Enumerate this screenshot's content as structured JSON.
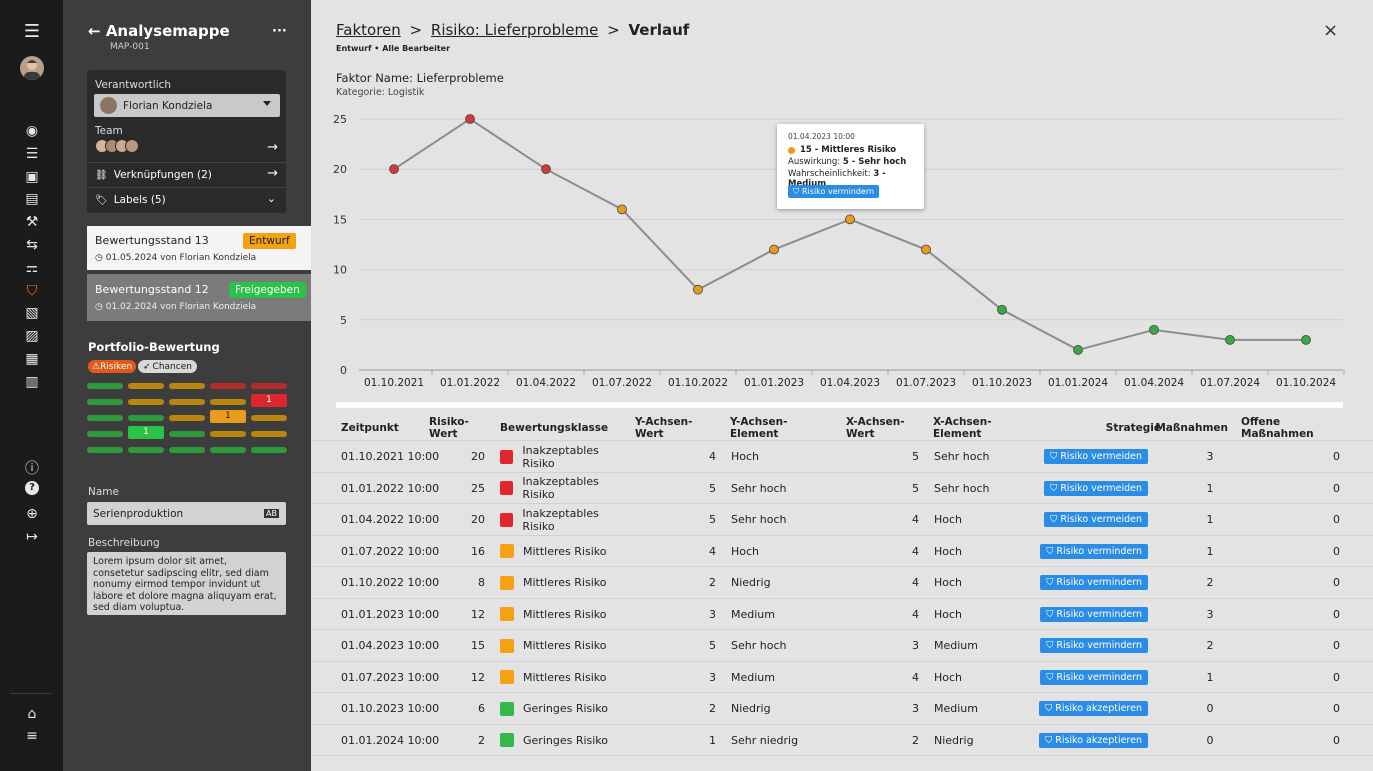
{
  "rail": {
    "top_icons": [
      "menu-icon",
      "avatar"
    ],
    "icons": [
      "dashboard-icon",
      "checklist-icon",
      "clipboard-icon",
      "shield-check-icon",
      "wrench-icon",
      "transfer-icon",
      "org-chart-icon",
      "risk-shield-icon",
      "document-check-icon",
      "document-list-icon",
      "table-icon",
      "library-icon"
    ],
    "help_icons": [
      "info-icon",
      "help-icon",
      "globe-icon",
      "logout-icon"
    ],
    "bottom_icons": [
      "factory-icon",
      "database-icon"
    ]
  },
  "panel": {
    "back_arrow": "←",
    "title": "Analysemappe",
    "subtitle": "MAP-001",
    "more": "···",
    "responsible_label": "Verantwortlich",
    "responsible_value": "Florian Kondziela",
    "team_label": "Team",
    "links_label": "Verknüpfungen (2)",
    "labels_label": "Labels (5)",
    "versions": [
      {
        "title": "Bewertungsstand 13",
        "badge": "Entwurf",
        "meta": "01.05.2024 von Florian Kondziela"
      },
      {
        "title": "Bewertungsstand 12",
        "badge": "Freigegeben",
        "meta": "01.02.2024 von Florian Kondziela"
      }
    ],
    "portfolio_title": "Portfolio-Bewertung",
    "tab_risks": "Risiken",
    "tab_chances": "Chancen",
    "heat_marks": [
      "1",
      "1",
      "1"
    ],
    "name_label": "Name",
    "name_value": "Serienproduktion",
    "desc_label": "Beschreibung",
    "desc_value": "Lorem ipsum dolor sit amet, consetetur sadipscing elitr, sed diam nonumy eirmod tempor invidunt ut labore et dolore magna aliquyam erat, sed diam voluptua."
  },
  "header": {
    "crumb1": "Faktoren",
    "crumb2": "Risiko: Lieferprobleme",
    "crumb3": "Verlauf",
    "sep": ">",
    "status": "Entwurf",
    "editors": "Alle Bearbeiter",
    "factor_name": "Faktor Name: Lieferprobleme",
    "category": "Kategorie: Logistik",
    "close": "×"
  },
  "tooltip": {
    "date": "01.04.2023 10:00",
    "value": "15",
    "class": "Mittleres Risiko",
    "impact_label": "Auswirkung:",
    "impact_value": "5 - Sehr hoch",
    "prob_label": "Wahrscheinlichkeit:",
    "prob_value": "3 - Medium",
    "button": "Risiko vermindern"
  },
  "chart_data": {
    "type": "line",
    "categories": [
      "01.10.2021",
      "01.01.2022",
      "01.04.2022",
      "01.07.2022",
      "01.10.2022",
      "01.01.2023",
      "01.04.2023",
      "01.07.2023",
      "01.10.2023",
      "01.01.2024",
      "01.04.2024",
      "01.07.2024",
      "01.10.2024"
    ],
    "values": [
      20,
      25,
      20,
      16,
      8,
      12,
      15,
      12,
      6,
      2,
      4,
      3,
      3
    ],
    "point_colors": [
      "#d23a3a",
      "#d23a3a",
      "#d23a3a",
      "#e89b1c",
      "#e89b1c",
      "#e89b1c",
      "#e89b1c",
      "#e89b1c",
      "#3aa845",
      "#3aa845",
      "#3aa845",
      "#3aa845",
      "#3aa845"
    ],
    "ylim": [
      0,
      25
    ],
    "yticks": [
      0,
      5,
      10,
      15,
      20,
      25
    ],
    "line_color": "#8c8c8c",
    "grid": true
  },
  "table": {
    "headers": [
      "Zeitpunkt",
      "Risiko-Wert",
      "Bewertungsklasse",
      "Y-Achsen-Wert",
      "Y-Achsen-Element",
      "X-Achsen-Wert",
      "X-Achsen-Element",
      "Strategie",
      "Maßnahmen",
      "Offene Maßnahmen"
    ],
    "rows": [
      {
        "time": "01.10.2021 10:00",
        "value": "20",
        "color": "#e0262d",
        "class": "Inakzeptables Risiko",
        "y": "4",
        "ye": "Hoch",
        "x": "5",
        "xe": "Sehr hoch",
        "strategy": "Risiko vermeiden",
        "m": "3",
        "om": "0"
      },
      {
        "time": "01.01.2022 10:00",
        "value": "25",
        "color": "#e0262d",
        "class": "Inakzeptables Risiko",
        "y": "5",
        "ye": "Sehr hoch",
        "x": "5",
        "xe": "Sehr hoch",
        "strategy": "Risiko vermeiden",
        "m": "1",
        "om": "0"
      },
      {
        "time": "01.04.2022 10:00",
        "value": "20",
        "color": "#e0262d",
        "class": "Inakzeptables Risiko",
        "y": "5",
        "ye": "Sehr hoch",
        "x": "4",
        "xe": "Hoch",
        "strategy": "Risiko vermeiden",
        "m": "1",
        "om": "0"
      },
      {
        "time": "01.07.2022 10:00",
        "value": "16",
        "color": "#f5a212",
        "class": "Mittleres Risiko",
        "y": "4",
        "ye": "Hoch",
        "x": "4",
        "xe": "Hoch",
        "strategy": "Risiko vermindern",
        "m": "1",
        "om": "0"
      },
      {
        "time": "01.10.2022 10:00",
        "value": "8",
        "color": "#f5a212",
        "class": "Mittleres Risiko",
        "y": "2",
        "ye": "Niedrig",
        "x": "4",
        "xe": "Hoch",
        "strategy": "Risiko vermindern",
        "m": "2",
        "om": "0"
      },
      {
        "time": "01.01.2023 10:00",
        "value": "12",
        "color": "#f5a212",
        "class": "Mittleres Risiko",
        "y": "3",
        "ye": "Medium",
        "x": "4",
        "xe": "Hoch",
        "strategy": "Risiko vermindern",
        "m": "3",
        "om": "0"
      },
      {
        "time": "01.04.2023 10:00",
        "value": "15",
        "color": "#f5a212",
        "class": "Mittleres Risiko",
        "y": "5",
        "ye": "Sehr hoch",
        "x": "3",
        "xe": "Medium",
        "strategy": "Risiko vermindern",
        "m": "2",
        "om": "0"
      },
      {
        "time": "01.07.2023 10:00",
        "value": "12",
        "color": "#f5a212",
        "class": "Mittleres Risiko",
        "y": "3",
        "ye": "Medium",
        "x": "4",
        "xe": "Hoch",
        "strategy": "Risiko vermindern",
        "m": "1",
        "om": "0"
      },
      {
        "time": "01.10.2023 10:00",
        "value": "6",
        "color": "#33b84a",
        "class": "Geringes Risiko",
        "y": "2",
        "ye": "Niedrig",
        "x": "3",
        "xe": "Medium",
        "strategy": "Risiko akzeptieren",
        "m": "0",
        "om": "0"
      },
      {
        "time": "01.01.2024 10:00",
        "value": "2",
        "color": "#33b84a",
        "class": "Geringes Risiko",
        "y": "1",
        "ye": "Sehr niedrig",
        "x": "2",
        "xe": "Niedrig",
        "strategy": "Risiko akzeptieren",
        "m": "0",
        "om": "0"
      }
    ]
  }
}
